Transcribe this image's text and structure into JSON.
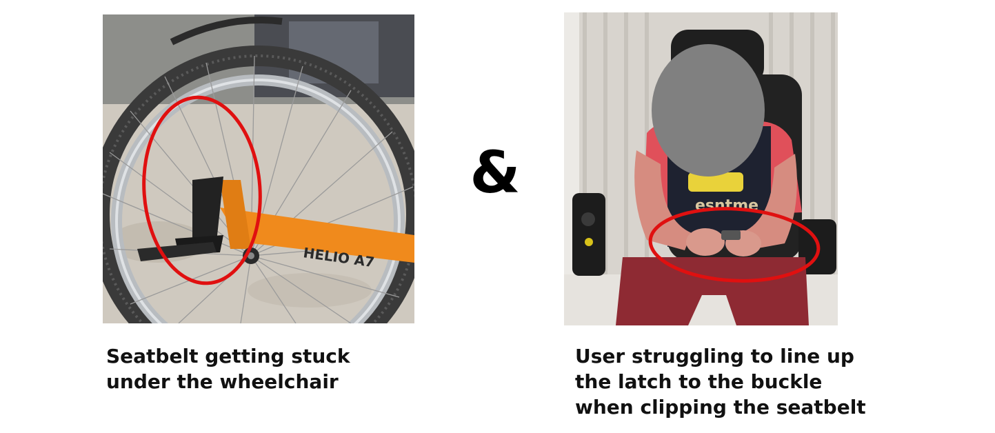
{
  "left_panel": {
    "photo_alt": "Wheelchair wheel with seatbelt caught underneath",
    "frame_brand": "HELIO A7",
    "caption_lines": [
      "Seatbelt getting stuck",
      "under the wheelchair"
    ]
  },
  "separator": {
    "symbol": "&"
  },
  "right_panel": {
    "photo_alt": "Seated user in power wheelchair holding seatbelt buckle",
    "shirt_text": "esntme",
    "caption_lines": [
      "User struggling to line up",
      "the latch to the buckle",
      "when clipping the seatbelt"
    ]
  },
  "colors": {
    "highlight_circle": "#e01010",
    "wheelchair_frame": "#f08a1c",
    "privacy_blur": "#808080"
  }
}
